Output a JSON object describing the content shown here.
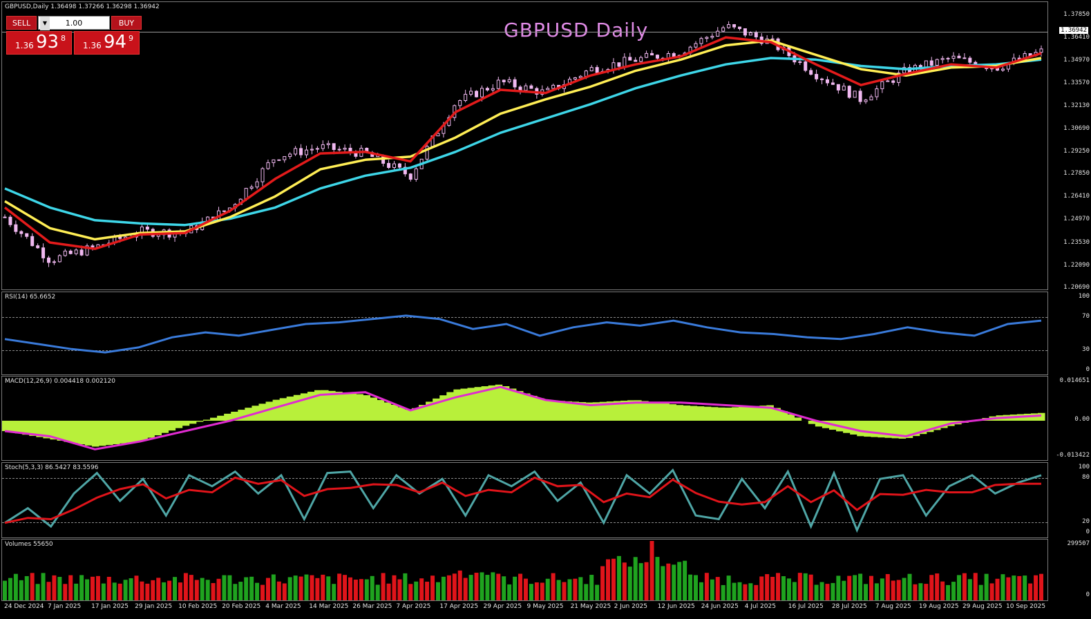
{
  "main_panel": {
    "label": "GBPUSD,Daily  1.36498 1.37266 1.36298 1.36942",
    "title_overlay": "GBPUSD Daily",
    "price_scale": [
      "1.37850",
      "1.36410",
      "1.34970",
      "1.33570",
      "1.32130",
      "1.30690",
      "1.29250",
      "1.27850",
      "1.26410",
      "1.24970",
      "1.23530",
      "1.22090",
      "1.20690"
    ],
    "last_price": "1.36942",
    "colors": {
      "ma_fast": "#e31b1b",
      "ma_mid": "#ffee55",
      "ma_slow": "#3ed6e8",
      "candle": "#f0b8f0"
    }
  },
  "trade_panel": {
    "sell_label": "SELL",
    "buy_label": "BUY",
    "lot_value": "1.00",
    "sell_price_small": "1.36",
    "sell_price_big": "93",
    "sell_price_sup": "8",
    "buy_price_small": "1.36",
    "buy_price_big": "94",
    "buy_price_sup": "9"
  },
  "rsi_panel": {
    "label": "RSI(14) 65.6652",
    "scale": [
      "100",
      "70",
      "30",
      "0"
    ],
    "color": "#3a7bdb"
  },
  "macd_panel": {
    "label": "MACD(12,26,9) 0.004418 0.002120",
    "scale": [
      "0.014651",
      "0.00",
      "-0.013422"
    ],
    "hist_color": "#b8f03a",
    "signal_color": "#e02bd0"
  },
  "stoch_panel": {
    "label": "Stoch(5,3,3) 86.5427 83.5596",
    "scale": [
      "100",
      "80",
      "20",
      "0"
    ],
    "main_color": "#4fa6a6",
    "signal_color": "#e0141a"
  },
  "volume_panel": {
    "label": "Volumes 55650",
    "scale": [
      "299507",
      "0"
    ],
    "up_color": "#1fa31f",
    "down_color": "#e0141a"
  },
  "date_axis": [
    "24 Dec 2024",
    "7 Jan 2025",
    "17 Jan 2025",
    "29 Jan 2025",
    "10 Feb 2025",
    "20 Feb 2025",
    "4 Mar 2025",
    "14 Mar 2025",
    "26 Mar 2025",
    "7 Apr 2025",
    "17 Apr 2025",
    "29 Apr 2025",
    "9 May 2025",
    "21 May 2025",
    "2 Jun 2025",
    "12 Jun 2025",
    "24 Jun 2025",
    "4 Jul 2025",
    "16 Jul 2025",
    "28 Jul 2025",
    "7 Aug 2025",
    "19 Aug 2025",
    "29 Aug 2025",
    "10 Sep 2025"
  ],
  "chart_data": {
    "type": "line",
    "title": "GBPUSD Daily",
    "x": [
      "24 Dec 2024",
      "7 Jan 2025",
      "17 Jan 2025",
      "29 Jan 2025",
      "10 Feb 2025",
      "20 Feb 2025",
      "4 Mar 2025",
      "14 Mar 2025",
      "26 Mar 2025",
      "7 Apr 2025",
      "17 Apr 2025",
      "29 Apr 2025",
      "9 May 2025",
      "21 May 2025",
      "2 Jun 2025",
      "12 Jun 2025",
      "24 Jun 2025",
      "4 Jul 2025",
      "16 Jul 2025",
      "28 Jul 2025",
      "7 Aug 2025",
      "19 Aug 2025",
      "29 Aug 2025",
      "10 Sep 2025"
    ],
    "series": [
      {
        "values": [
          1.252,
          1.225,
          1.233,
          1.243,
          1.242,
          1.258,
          1.29,
          1.296,
          1.292,
          1.278,
          1.324,
          1.337,
          1.33,
          1.345,
          1.351,
          1.356,
          1.372,
          1.362,
          1.342,
          1.326,
          1.344,
          1.352,
          1.346,
          1.356
        ]
      },
      {
        "values": [
          1.262,
          1.245,
          1.238,
          1.242,
          1.243,
          1.252,
          1.265,
          1.282,
          1.288,
          1.29,
          1.302,
          1.317,
          1.326,
          1.334,
          1.344,
          1.351,
          1.36,
          1.363,
          1.354,
          1.345,
          1.341,
          1.346,
          1.347,
          1.352
        ]
      },
      {
        "values": [
          1.258,
          1.236,
          1.232,
          1.241,
          1.242,
          1.256,
          1.276,
          1.292,
          1.293,
          1.287,
          1.318,
          1.332,
          1.33,
          1.341,
          1.348,
          1.353,
          1.365,
          1.362,
          1.348,
          1.335,
          1.342,
          1.348,
          1.346,
          1.355
        ]
      },
      {
        "values": [
          1.27,
          1.258,
          1.25,
          1.248,
          1.247,
          1.251,
          1.258,
          1.27,
          1.278,
          1.283,
          1.293,
          1.305,
          1.314,
          1.323,
          1.333,
          1.341,
          1.348,
          1.352,
          1.351,
          1.347,
          1.345,
          1.347,
          1.348,
          1.351
        ]
      }
    ],
    "ylim": [
      1.2069,
      1.3785
    ]
  }
}
